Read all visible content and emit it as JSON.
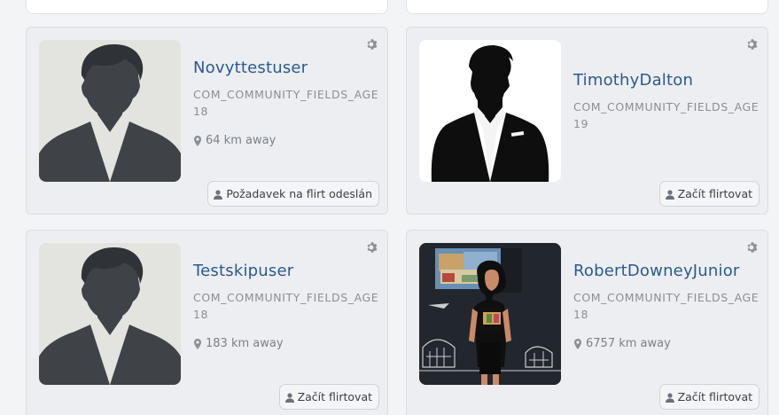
{
  "profiles": [
    {
      "name": "Novyttestuser",
      "field": "COM_COMMUNITY_FIELDS_AGE 18",
      "distance": "64 km away",
      "action": "Požadavek na flirt odeslán",
      "avatar": "default-silhouette"
    },
    {
      "name": "TimothyDalton",
      "field": "COM_COMMUNITY_FIELDS_AGE 19",
      "distance": "",
      "action": "Začít flirtovat",
      "avatar": "suit-silhouette"
    },
    {
      "name": "Testskipuser",
      "field": "COM_COMMUNITY_FIELDS_AGE 18",
      "distance": "183 km away",
      "action": "Začít flirtovat",
      "avatar": "default-silhouette"
    },
    {
      "name": "RobertDowneyJunior",
      "field": "COM_COMMUNITY_FIELDS_AGE 18",
      "distance": "6757 km away",
      "action": "Začít flirtovat",
      "avatar": "photo"
    }
  ],
  "colors": {
    "name": "#2a5a8f",
    "card_bg": "#eceef1",
    "muted": "#8a8f96"
  },
  "icons": {
    "settings": "gear-icon",
    "location": "map-pin-icon",
    "user": "user-icon"
  }
}
